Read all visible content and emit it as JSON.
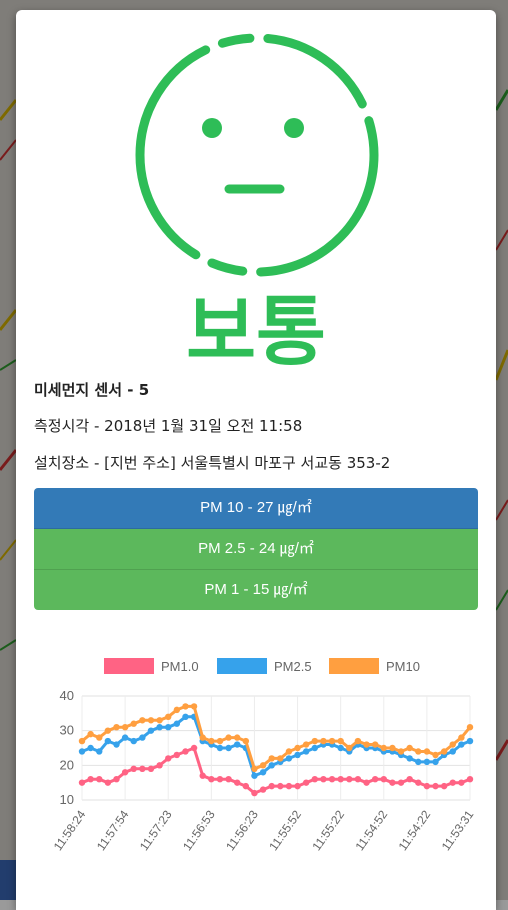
{
  "status": {
    "label": "보통",
    "color": "#2ebd57",
    "face_icon": "neutral-face-icon"
  },
  "sensor": {
    "name": "미세먼지 센서 - 5",
    "measured_at": "측정시각 - 2018년 1월 31일 오전 11:58",
    "location": "설치장소 - [지번 주소] 서울특별시 마포구 서교동 353-2"
  },
  "pm_items": [
    {
      "label": "PM 10 - 27 ㎍/㎡",
      "color": "#337ab7"
    },
    {
      "label": "PM 2.5 - 24 ㎍/㎡",
      "color": "#5cb85c"
    },
    {
      "label": "PM 1 - 15 ㎍/㎡",
      "color": "#5cb85c"
    }
  ],
  "chart_data": {
    "type": "line",
    "ylim": [
      10,
      40
    ],
    "yticks": [
      10,
      20,
      30,
      40
    ],
    "xtick_labels": [
      "11:58:24",
      "11:57:54",
      "11:57:23",
      "11:56:53",
      "11:56:23",
      "11:55:52",
      "11:55:22",
      "11:54:52",
      "11:54:22",
      "11:53:31"
    ],
    "grid": true,
    "legend_position": "top",
    "series": [
      {
        "name": "PM1.0",
        "color": "#ff6384",
        "values": [
          15,
          16,
          16,
          15,
          16,
          18,
          19,
          19,
          19,
          20,
          22,
          23,
          24,
          25,
          17,
          16,
          16,
          16,
          15,
          14,
          12,
          13,
          14,
          14,
          14,
          14,
          15,
          16,
          16,
          16,
          16,
          16,
          16,
          15,
          16,
          16,
          15,
          15,
          16,
          15,
          14,
          14,
          14,
          15,
          15,
          16
        ]
      },
      {
        "name": "PM2.5",
        "color": "#36a2eb",
        "values": [
          24,
          25,
          24,
          27,
          26,
          28,
          27,
          28,
          30,
          31,
          31,
          32,
          34,
          34,
          27,
          26,
          25,
          25,
          26,
          25,
          17,
          18,
          20,
          21,
          22,
          23,
          24,
          25,
          26,
          26,
          25,
          24,
          26,
          25,
          25,
          24,
          24,
          23,
          22,
          21,
          21,
          21,
          23,
          24,
          26,
          27
        ]
      },
      {
        "name": "PM10",
        "color": "#ff9f40",
        "values": [
          27,
          29,
          28,
          30,
          31,
          31,
          32,
          33,
          33,
          33,
          34,
          36,
          37,
          37,
          28,
          27,
          27,
          28,
          28,
          27,
          19,
          20,
          22,
          22,
          24,
          25,
          26,
          27,
          27,
          27,
          27,
          25,
          27,
          26,
          26,
          25,
          25,
          24,
          25,
          24,
          24,
          23,
          24,
          26,
          28,
          31
        ]
      }
    ]
  }
}
